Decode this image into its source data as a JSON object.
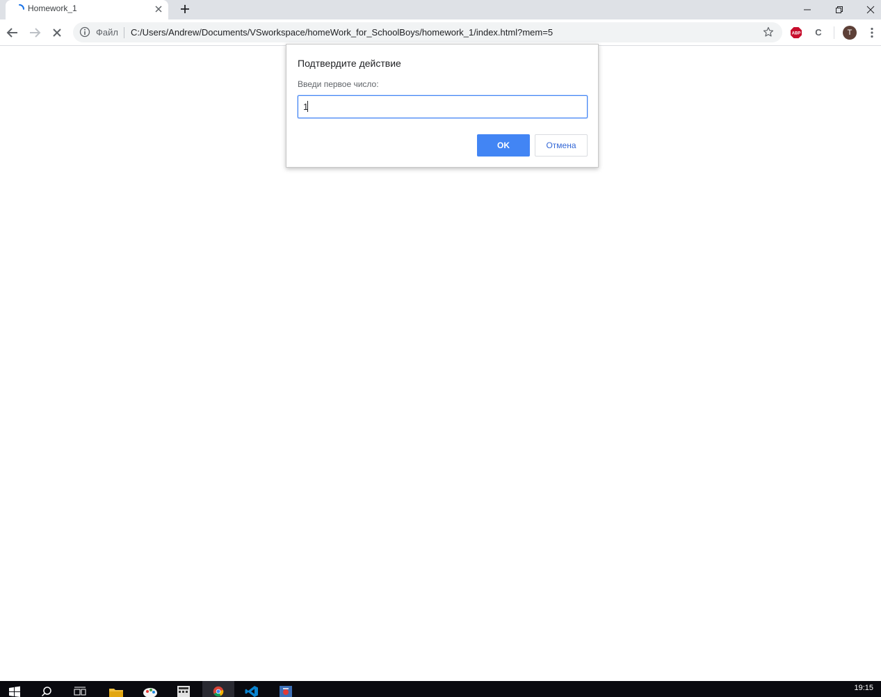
{
  "browser": {
    "tab": {
      "title": "Homework_1",
      "spinner_icon": "loading-spinner-icon"
    },
    "omnibox": {
      "origin_chip": "Файл",
      "url": "C:/Users/Andrew/Documents/VSworkspace/homeWork_for_SchoolBoys/homework_1/index.html?mem=5"
    },
    "profile": {
      "initial": "T",
      "color": "#5d4037"
    },
    "extensions": [
      {
        "name": "AdBlock Plus",
        "label": "ABP",
        "color": "#c70d2c"
      },
      {
        "name": "C extension",
        "label": "C"
      }
    ]
  },
  "dialog": {
    "title": "Подтвердите действие",
    "message": "Введи первое число:",
    "input_value": "1",
    "ok_label": "OK",
    "cancel_label": "Отмена",
    "accent_color": "#4285f4"
  },
  "taskbar": {
    "items": [
      "start-icon",
      "search-icon",
      "task-view-icon",
      "file-explorer-icon",
      "paint-icon",
      "calculator-icon",
      "chrome-icon",
      "vscode-icon",
      "app-icon"
    ],
    "clock": "19:15"
  }
}
